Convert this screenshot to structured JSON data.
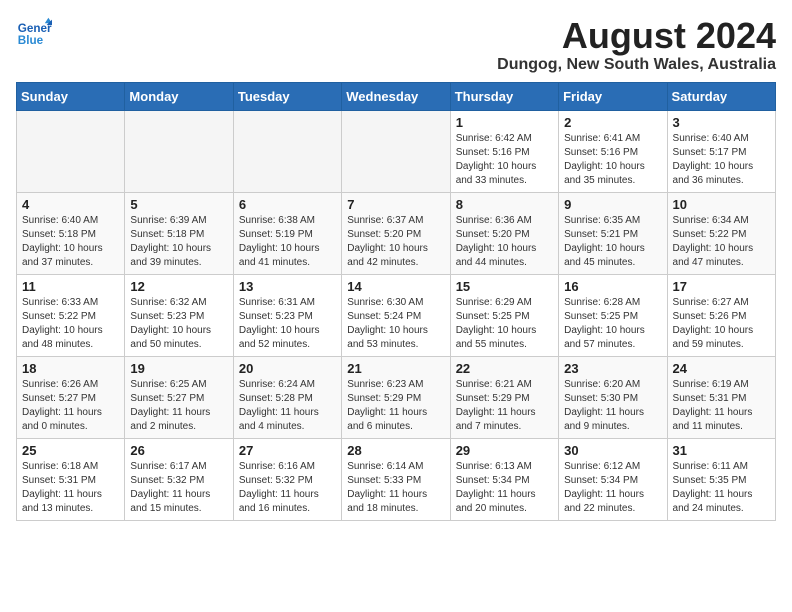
{
  "header": {
    "logo_line1": "General",
    "logo_line2": "Blue",
    "month_year": "August 2024",
    "location": "Dungog, New South Wales, Australia"
  },
  "days_of_week": [
    "Sunday",
    "Monday",
    "Tuesday",
    "Wednesday",
    "Thursday",
    "Friday",
    "Saturday"
  ],
  "weeks": [
    [
      {
        "day": "",
        "info": ""
      },
      {
        "day": "",
        "info": ""
      },
      {
        "day": "",
        "info": ""
      },
      {
        "day": "",
        "info": ""
      },
      {
        "day": "1",
        "info": "Sunrise: 6:42 AM\nSunset: 5:16 PM\nDaylight: 10 hours\nand 33 minutes."
      },
      {
        "day": "2",
        "info": "Sunrise: 6:41 AM\nSunset: 5:16 PM\nDaylight: 10 hours\nand 35 minutes."
      },
      {
        "day": "3",
        "info": "Sunrise: 6:40 AM\nSunset: 5:17 PM\nDaylight: 10 hours\nand 36 minutes."
      }
    ],
    [
      {
        "day": "4",
        "info": "Sunrise: 6:40 AM\nSunset: 5:18 PM\nDaylight: 10 hours\nand 37 minutes."
      },
      {
        "day": "5",
        "info": "Sunrise: 6:39 AM\nSunset: 5:18 PM\nDaylight: 10 hours\nand 39 minutes."
      },
      {
        "day": "6",
        "info": "Sunrise: 6:38 AM\nSunset: 5:19 PM\nDaylight: 10 hours\nand 41 minutes."
      },
      {
        "day": "7",
        "info": "Sunrise: 6:37 AM\nSunset: 5:20 PM\nDaylight: 10 hours\nand 42 minutes."
      },
      {
        "day": "8",
        "info": "Sunrise: 6:36 AM\nSunset: 5:20 PM\nDaylight: 10 hours\nand 44 minutes."
      },
      {
        "day": "9",
        "info": "Sunrise: 6:35 AM\nSunset: 5:21 PM\nDaylight: 10 hours\nand 45 minutes."
      },
      {
        "day": "10",
        "info": "Sunrise: 6:34 AM\nSunset: 5:22 PM\nDaylight: 10 hours\nand 47 minutes."
      }
    ],
    [
      {
        "day": "11",
        "info": "Sunrise: 6:33 AM\nSunset: 5:22 PM\nDaylight: 10 hours\nand 48 minutes."
      },
      {
        "day": "12",
        "info": "Sunrise: 6:32 AM\nSunset: 5:23 PM\nDaylight: 10 hours\nand 50 minutes."
      },
      {
        "day": "13",
        "info": "Sunrise: 6:31 AM\nSunset: 5:23 PM\nDaylight: 10 hours\nand 52 minutes."
      },
      {
        "day": "14",
        "info": "Sunrise: 6:30 AM\nSunset: 5:24 PM\nDaylight: 10 hours\nand 53 minutes."
      },
      {
        "day": "15",
        "info": "Sunrise: 6:29 AM\nSunset: 5:25 PM\nDaylight: 10 hours\nand 55 minutes."
      },
      {
        "day": "16",
        "info": "Sunrise: 6:28 AM\nSunset: 5:25 PM\nDaylight: 10 hours\nand 57 minutes."
      },
      {
        "day": "17",
        "info": "Sunrise: 6:27 AM\nSunset: 5:26 PM\nDaylight: 10 hours\nand 59 minutes."
      }
    ],
    [
      {
        "day": "18",
        "info": "Sunrise: 6:26 AM\nSunset: 5:27 PM\nDaylight: 11 hours\nand 0 minutes."
      },
      {
        "day": "19",
        "info": "Sunrise: 6:25 AM\nSunset: 5:27 PM\nDaylight: 11 hours\nand 2 minutes."
      },
      {
        "day": "20",
        "info": "Sunrise: 6:24 AM\nSunset: 5:28 PM\nDaylight: 11 hours\nand 4 minutes."
      },
      {
        "day": "21",
        "info": "Sunrise: 6:23 AM\nSunset: 5:29 PM\nDaylight: 11 hours\nand 6 minutes."
      },
      {
        "day": "22",
        "info": "Sunrise: 6:21 AM\nSunset: 5:29 PM\nDaylight: 11 hours\nand 7 minutes."
      },
      {
        "day": "23",
        "info": "Sunrise: 6:20 AM\nSunset: 5:30 PM\nDaylight: 11 hours\nand 9 minutes."
      },
      {
        "day": "24",
        "info": "Sunrise: 6:19 AM\nSunset: 5:31 PM\nDaylight: 11 hours\nand 11 minutes."
      }
    ],
    [
      {
        "day": "25",
        "info": "Sunrise: 6:18 AM\nSunset: 5:31 PM\nDaylight: 11 hours\nand 13 minutes."
      },
      {
        "day": "26",
        "info": "Sunrise: 6:17 AM\nSunset: 5:32 PM\nDaylight: 11 hours\nand 15 minutes."
      },
      {
        "day": "27",
        "info": "Sunrise: 6:16 AM\nSunset: 5:32 PM\nDaylight: 11 hours\nand 16 minutes."
      },
      {
        "day": "28",
        "info": "Sunrise: 6:14 AM\nSunset: 5:33 PM\nDaylight: 11 hours\nand 18 minutes."
      },
      {
        "day": "29",
        "info": "Sunrise: 6:13 AM\nSunset: 5:34 PM\nDaylight: 11 hours\nand 20 minutes."
      },
      {
        "day": "30",
        "info": "Sunrise: 6:12 AM\nSunset: 5:34 PM\nDaylight: 11 hours\nand 22 minutes."
      },
      {
        "day": "31",
        "info": "Sunrise: 6:11 AM\nSunset: 5:35 PM\nDaylight: 11 hours\nand 24 minutes."
      }
    ]
  ]
}
